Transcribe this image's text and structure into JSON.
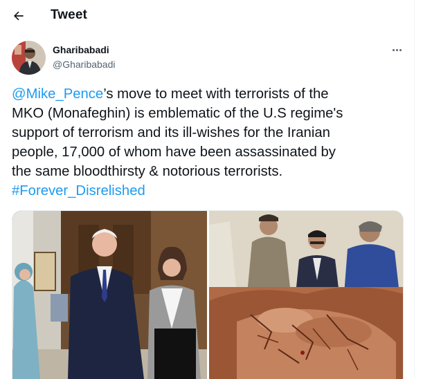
{
  "header": {
    "title": "Tweet"
  },
  "author": {
    "name": "Gharibabadi",
    "handle": "@Gharibabadi"
  },
  "tweet": {
    "lines": [
      {
        "mention": "@Mike_Pence",
        "text": "’s move to meet with terrorists of the"
      },
      {
        "text": "MKO (Monafeghin) is emblematic of the U.S regime's"
      },
      {
        "text": "support of terrorism and its ill-wishes for the Iranian"
      },
      {
        "text": "people, 17,000 of whom have been assassinated by"
      },
      {
        "text": "the same bloodthirsty & notorious terrorists."
      },
      {
        "hashtag": "#Forever_Disrelished"
      }
    ]
  },
  "icons": {
    "back": "arrow-left-icon",
    "more": "more-horizontal-icon"
  },
  "colors": {
    "link": "#1d9bf0",
    "text": "#0f1419",
    "secondary": "#536471"
  }
}
